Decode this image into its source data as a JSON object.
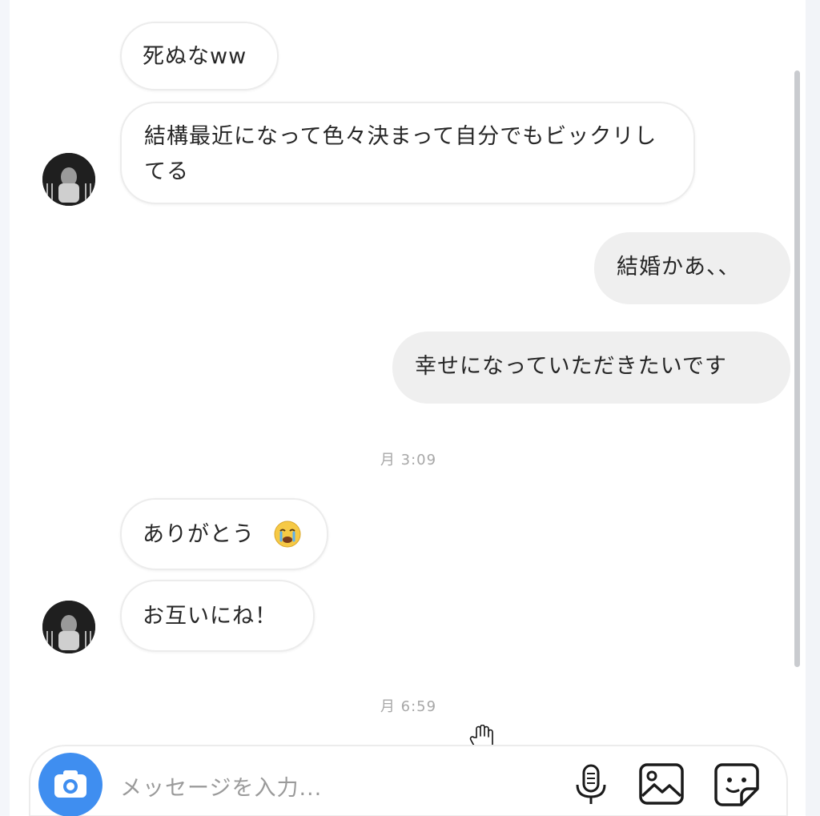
{
  "conversation": {
    "messages": [
      {
        "direction": "incoming",
        "text": "死ぬなww"
      },
      {
        "direction": "incoming",
        "text": "結構最近になって色々決まって自分でもビックリしてる"
      },
      {
        "direction": "outgoing",
        "text": "結婚かあ、、"
      },
      {
        "direction": "outgoing",
        "text": "幸せになっていただきたいです"
      },
      {
        "direction": "incoming",
        "text": "ありがとう"
      },
      {
        "direction": "incoming",
        "text": "お互いにね！"
      }
    ],
    "timestamps": [
      "月 3:09",
      "月 6:59"
    ]
  },
  "composer": {
    "placeholder": "メッセージを入力...",
    "icons": [
      "camera-icon",
      "microphone-icon",
      "image-icon",
      "sticker-icon"
    ]
  },
  "colors": {
    "accent": "#3f8ef0",
    "outgoing_bubble": "#efefef",
    "incoming_bubble": "#ffffff"
  }
}
